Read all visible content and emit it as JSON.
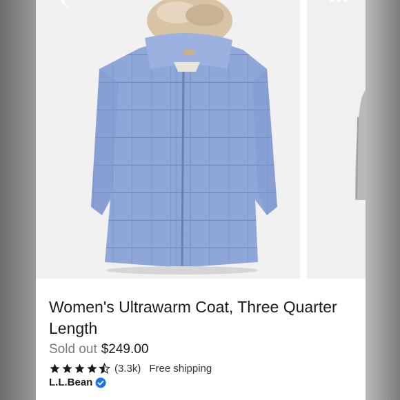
{
  "listing": {
    "title": "Women's Ultrawarm Coat, Three Quarter Length",
    "status": "Sold out",
    "price": "$249.00",
    "rating": 4.5,
    "review_count": "(3.3k)",
    "shipping": "Free shipping",
    "brand": "L.L.Bean"
  },
  "colors": {
    "coat": "#8fa6d8",
    "fur": "#d8c3a6",
    "verified": "#1a73e8"
  },
  "icons": [
    "back-arrow-icon",
    "more-options-icon",
    "star-icon",
    "half-star-icon",
    "verified-badge-icon"
  ]
}
